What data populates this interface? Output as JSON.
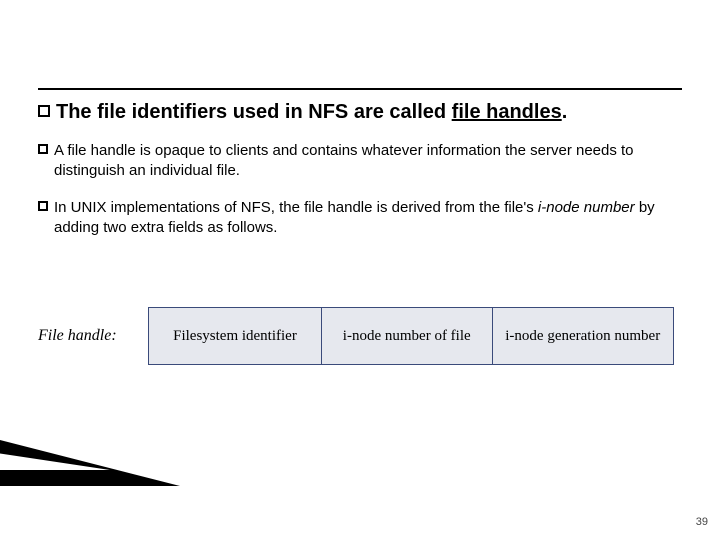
{
  "bullets": {
    "main": {
      "prefix": "The file identifiers used in NFS are called ",
      "underlined": "file handles",
      "suffix": "."
    },
    "sub1": "A file handle is opaque to clients and contains whatever information the server needs to distinguish an individual file.",
    "sub2": {
      "prefix": "In UNIX implementations of NFS, the file handle is derived from the file's ",
      "italic": "i-node number",
      "suffix": " by adding two extra fields as follows."
    }
  },
  "figure": {
    "label": "File handle:",
    "cells": [
      "Filesystem identifier",
      "i-node number of file",
      "i-node generation number"
    ]
  },
  "page_number": "39"
}
